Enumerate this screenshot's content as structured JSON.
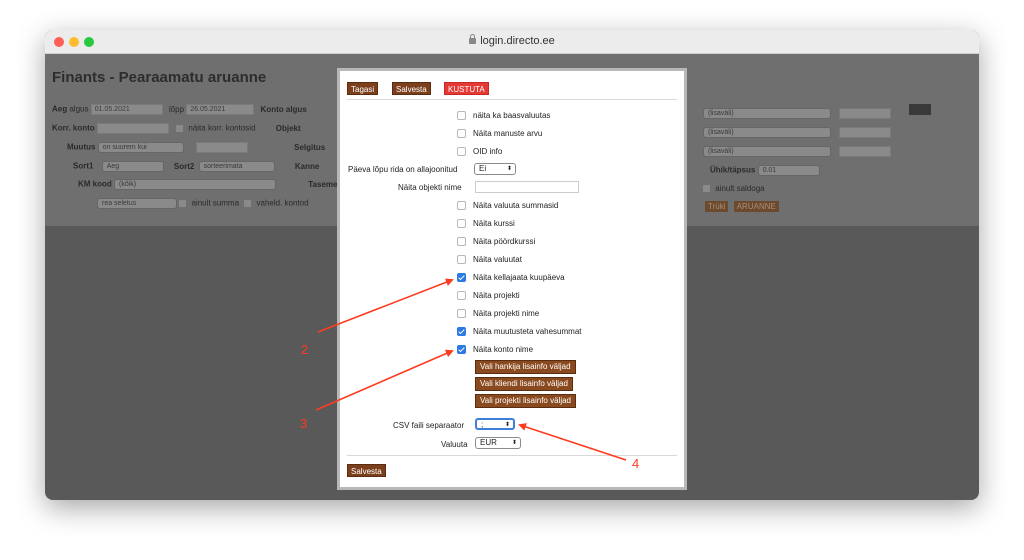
{
  "browser": {
    "url": "login.directo.ee"
  },
  "background": {
    "title": "Finants - Pearaamatu aruanne",
    "row1": {
      "aeg": "Aeg",
      "algus_label": "algus",
      "algus": "01.05.2021",
      "lopp_label": "lõpp",
      "lopp": "26.05.2021",
      "konto_algus": "Konto algus"
    },
    "row2": {
      "korr_konto": "Korr. konto",
      "naita_korr": "näita korr. kontosid",
      "objekt": "Objekt"
    },
    "row3": {
      "muutus": "Muutus",
      "muutus_sel": "on suurem kui",
      "selgitus": "Selgitus"
    },
    "row4": {
      "sort1": "Sort1",
      "sort1_sel": "Aeg",
      "sort2": "Sort2",
      "sort2_sel": "sorteerimata",
      "kanne": "Kanne"
    },
    "row5": {
      "km_kood": "KM kood",
      "km_sel": "(kõik)",
      "tasemete": "Tasemete"
    },
    "row6": {
      "rea_sel": "rea seletus",
      "ainult_summa": "ainult summa",
      "vaheld": "vaheld. kontod"
    },
    "right": {
      "lisavali1": "(lisaväli)",
      "lisavali2": "(lisaväli)",
      "lisavali3": "(lisaväli)",
      "uhik_label": "Ühik/täpsus",
      "uhik_val": "0.01",
      "ainult_saldoga": "ainult saldoga",
      "truki": "Trüki",
      "aruanne": "ARUANNE"
    }
  },
  "dialog": {
    "tagasi": "Tagasi",
    "salvesta_top": "Salvesta",
    "kustuta": "KUSTUTA",
    "opt1": "näita ka baasvaluutas",
    "opt2": "Näita manuste arvu",
    "opt3": "OID info",
    "paeva_label": "Päeva lõpu rida on allajoonitud",
    "paeva_val": "Ei",
    "objekti_label": "Näita objekti nime",
    "opt4": "Näita valuuta summasid",
    "opt5": "Näita kurssi",
    "opt6": "Näita pöördkurssi",
    "opt7": "Näita valuutat",
    "opt8": "Näita kellajaata kuupäeva",
    "opt9": "Näita projekti",
    "opt10": "Näita projekti nime",
    "opt11": "Näita muutusteta vahesummat",
    "opt12": "Näita konto nime",
    "btn_hankija": "Vali hankija lisainfo väljad",
    "btn_kliendi": "Vali kliendi lisainfo väljad",
    "btn_projekti": "Vali projekti lisainfo väljad",
    "csv_label": "CSV faili separaator",
    "csv_val": ";",
    "valuuta_label": "Valuuta",
    "valuuta_val": "EUR",
    "salvesta_bottom": "Salvesta"
  },
  "annotations": {
    "n2": "2",
    "n3": "3",
    "n4": "4",
    "color": "#ff3b1f"
  }
}
